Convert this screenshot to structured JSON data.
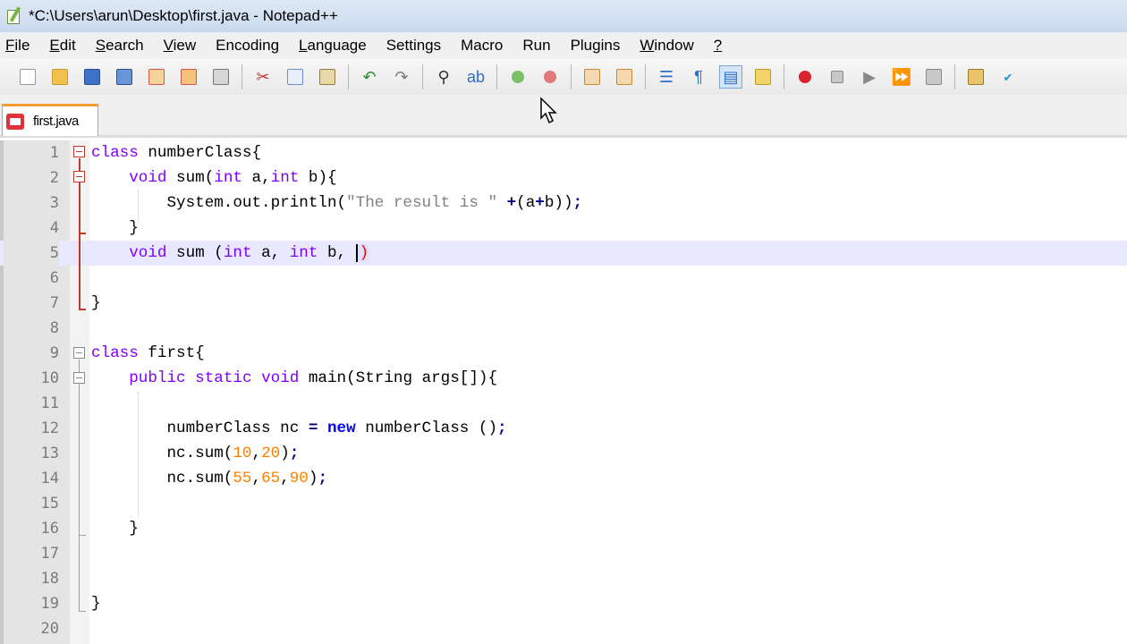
{
  "window": {
    "title": "*C:\\Users\\arun\\Desktop\\first.java - Notepad++"
  },
  "menu": {
    "items": [
      {
        "label": "File",
        "key": "F",
        "rest": "ile"
      },
      {
        "label": "Edit",
        "key": "E",
        "rest": "dit"
      },
      {
        "label": "Search",
        "key": "S",
        "rest": "earch"
      },
      {
        "label": "View",
        "key": "V",
        "rest": "iew"
      },
      {
        "label": "Encoding",
        "key": "",
        "rest": "Encoding"
      },
      {
        "label": "Language",
        "key": "L",
        "rest": "anguage"
      },
      {
        "label": "Settings",
        "key": "",
        "rest": "Settings"
      },
      {
        "label": "Macro",
        "key": "",
        "rest": "Macro"
      },
      {
        "label": "Run",
        "key": "",
        "rest": "Run"
      },
      {
        "label": "Plugins",
        "key": "",
        "rest": "Plugins"
      },
      {
        "label": "Window",
        "key": "W",
        "rest": "indow"
      },
      {
        "label": "?",
        "key": "?",
        "rest": ""
      }
    ]
  },
  "toolbar": {
    "icons": [
      "new-file-icon",
      "open-file-icon",
      "save-icon",
      "save-all-icon",
      "close-icon",
      "close-all-icon",
      "print-icon",
      "cut-icon",
      "copy-icon",
      "paste-icon",
      "undo-icon",
      "redo-icon",
      "find-icon",
      "replace-icon",
      "zoom-in-icon",
      "zoom-out-icon",
      "sync-vertical-icon",
      "sync-horizontal-icon",
      "word-wrap-icon",
      "show-all-characters-icon",
      "indent-guide-icon",
      "document-map-icon",
      "record-macro-icon",
      "stop-recording-icon",
      "playback-macro-icon",
      "run-macro-multiple-icon",
      "save-macro-icon",
      "launch-browser-icon",
      "spell-check-icon"
    ]
  },
  "tabs": [
    {
      "label": "first.java",
      "active": true
    }
  ],
  "editor": {
    "lines": [
      {
        "n": "1",
        "text": "class numberClass{"
      },
      {
        "n": "2",
        "text": "    void sum(int a,int b){"
      },
      {
        "n": "3",
        "text": "        System.out.println(\"The result is \" +(a+b));"
      },
      {
        "n": "4",
        "text": "    }"
      },
      {
        "n": "5",
        "text": "    void sum (int a, int b, )"
      },
      {
        "n": "6",
        "text": ""
      },
      {
        "n": "7",
        "text": "}"
      },
      {
        "n": "8",
        "text": ""
      },
      {
        "n": "9",
        "text": "class first{"
      },
      {
        "n": "10",
        "text": "    public static void main(String args[]){"
      },
      {
        "n": "11",
        "text": ""
      },
      {
        "n": "12",
        "text": "        numberClass nc = new numberClass ();"
      },
      {
        "n": "13",
        "text": "        nc.sum(10,20);"
      },
      {
        "n": "14",
        "text": "        nc.sum(55,65,90);"
      },
      {
        "n": "15",
        "text": ""
      },
      {
        "n": "16",
        "text": "    }"
      },
      {
        "n": "17",
        "text": ""
      },
      {
        "n": "18",
        "text": ""
      },
      {
        "n": "19",
        "text": "}"
      },
      {
        "n": "20",
        "text": ""
      }
    ],
    "current_line": 5
  },
  "colors": {
    "keyword": "#8000ff",
    "new_keyword": "#0000ff",
    "string": "#808080",
    "number": "#ff8000",
    "operator": "#000080",
    "fold_marker": "#c0392b",
    "tab_accent": "#f39a32"
  }
}
